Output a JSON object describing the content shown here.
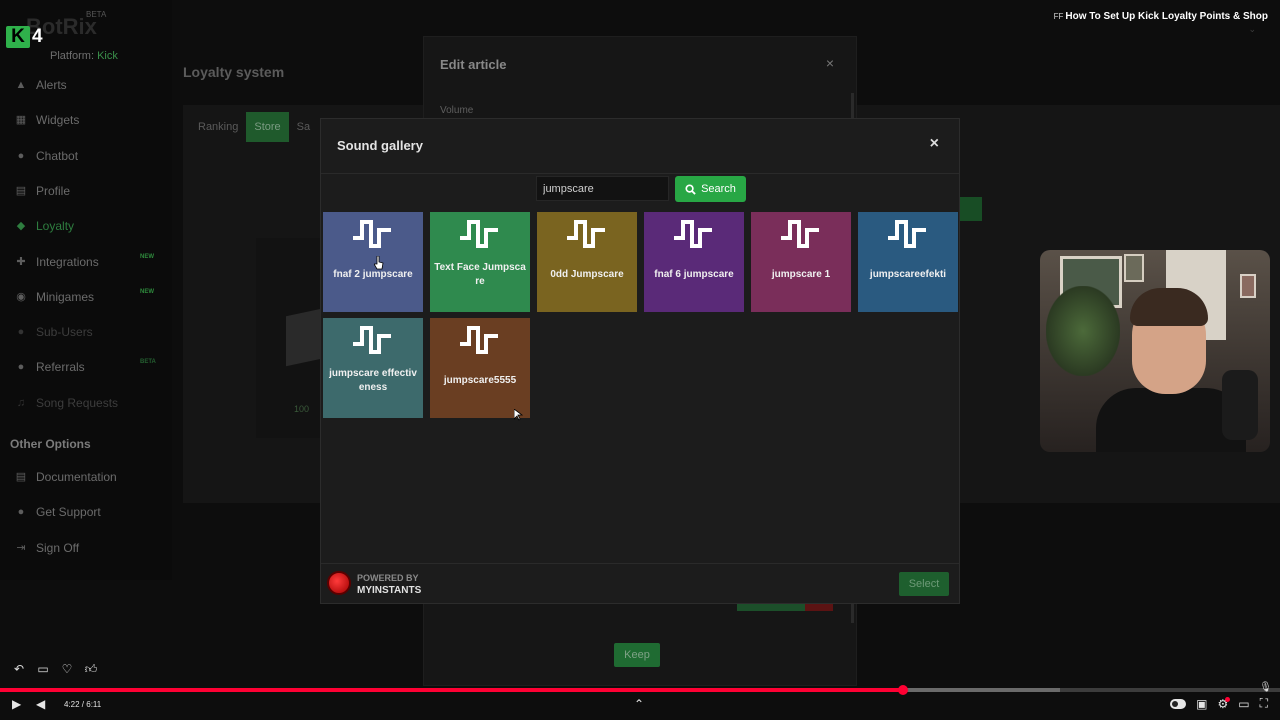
{
  "app": {
    "brand": "BotRix",
    "beta_tag": "BETA",
    "channel_count": "4",
    "platform_label": "Platform:",
    "platform_value": "Kick"
  },
  "sidebar": {
    "items": [
      {
        "label": "Alerts",
        "icon": "warning-icon"
      },
      {
        "label": "Widgets",
        "icon": "grid-icon"
      },
      {
        "label": "Chatbot",
        "icon": "chat-icon"
      },
      {
        "label": "Profile",
        "icon": "profile-icon"
      },
      {
        "label": "Loyalty",
        "icon": "loyalty-icon"
      },
      {
        "label": "Integrations",
        "icon": "integrations-icon",
        "badge": "NEW"
      },
      {
        "label": "Minigames",
        "icon": "gamepad-icon",
        "badge": "NEW"
      },
      {
        "label": "Sub-Users",
        "icon": "users-icon"
      },
      {
        "label": "Referrals",
        "icon": "referrals-icon",
        "badge": "BETA"
      },
      {
        "label": "Song Requests",
        "icon": "music-icon"
      }
    ],
    "other_options_title": "Other Options",
    "other_items": [
      {
        "label": "Documentation",
        "icon": "document-icon"
      },
      {
        "label": "Get Support",
        "icon": "support-icon"
      },
      {
        "label": "Sign Off",
        "icon": "signout-icon"
      }
    ]
  },
  "page": {
    "title": "Loyalty system",
    "tabs": [
      "Ranking",
      "Store",
      "Sa"
    ],
    "ghost_text": "100"
  },
  "edit_article": {
    "title": "Edit article",
    "close": "×",
    "volume_label": "Volume",
    "keep_label": "Keep"
  },
  "gallery": {
    "title": "Sound gallery",
    "close": "×",
    "search_value": "jumpscare",
    "search_button": "Search",
    "sounds": [
      {
        "label": "fnaf 2 jumpscare",
        "color": "#4b5a8a"
      },
      {
        "label": "Text Face Jumpscare",
        "color": "#2f8a4e"
      },
      {
        "label": "0dd Jumpscare",
        "color": "#7a6420"
      },
      {
        "label": "fnaf 6 jumpscare",
        "color": "#5a2a78"
      },
      {
        "label": "jumpscare 1",
        "color": "#7a2e5a"
      },
      {
        "label": "jumpscareefekti",
        "color": "#2a5a80"
      },
      {
        "label": "jumpscare effectiveness",
        "color": "#3d6a6c"
      },
      {
        "label": "jumpscare5555",
        "color": "#6a3e22"
      }
    ],
    "powered_by": "POWERED BY",
    "provider": "MYINSTANTS",
    "select_label": "Select"
  },
  "video": {
    "title": "How To Set Up Kick Loyalty Points & Shop",
    "title_prefix": "FF",
    "time_current": "4:22",
    "time_total": "6:11",
    "time_display": "4:22 / 6:11",
    "progress_played": 0.7055,
    "progress_buffered": 0.828,
    "accent_color": "#ff0033"
  }
}
